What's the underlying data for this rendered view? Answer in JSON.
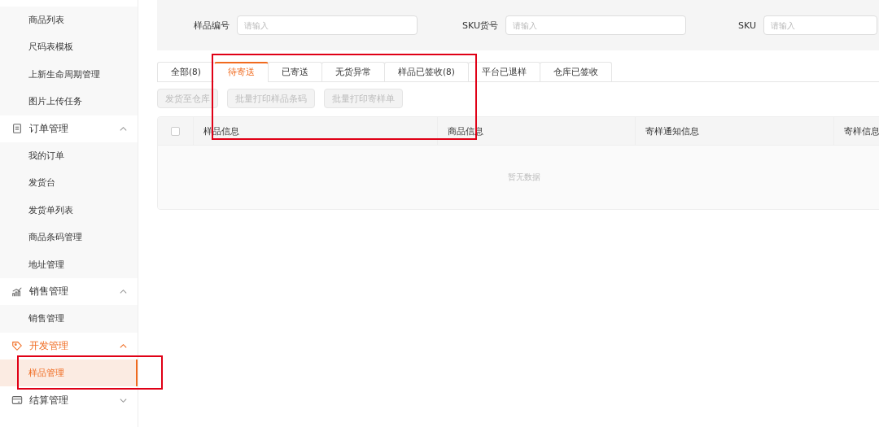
{
  "sidebar": {
    "items": [
      {
        "kind": "sub",
        "label": "商品列表",
        "selected": false
      },
      {
        "kind": "sub",
        "label": "尺码表模板",
        "selected": false
      },
      {
        "kind": "sub",
        "label": "上新生命周期管理",
        "selected": false
      },
      {
        "kind": "sub",
        "label": "图片上传任务",
        "selected": false
      },
      {
        "kind": "group",
        "label": "订单管理",
        "expanded": true,
        "selected": false
      },
      {
        "kind": "sub",
        "label": "我的订单",
        "selected": false
      },
      {
        "kind": "sub",
        "label": "发货台",
        "selected": false
      },
      {
        "kind": "sub",
        "label": "发货单列表",
        "selected": false
      },
      {
        "kind": "sub",
        "label": "商品条码管理",
        "selected": false
      },
      {
        "kind": "sub",
        "label": "地址管理",
        "selected": false
      },
      {
        "kind": "group",
        "label": "销售管理",
        "expanded": true,
        "selected": false
      },
      {
        "kind": "sub",
        "label": "销售管理",
        "selected": false
      },
      {
        "kind": "group",
        "label": "开发管理",
        "expanded": true,
        "selected": true
      },
      {
        "kind": "sub",
        "label": "样品管理",
        "selected": true
      },
      {
        "kind": "group",
        "label": "结算管理",
        "expanded": false,
        "selected": false
      }
    ]
  },
  "filters": [
    {
      "label": "样品编号",
      "placeholder": "请输入"
    },
    {
      "label": "SKU货号",
      "placeholder": "请输入"
    },
    {
      "label": "SKU",
      "placeholder": "请输入"
    }
  ],
  "tabs": [
    {
      "label": "全部(8)",
      "selected": false
    },
    {
      "label": "待寄送",
      "selected": true
    },
    {
      "label": "已寄送",
      "selected": false
    },
    {
      "label": "无货异常",
      "selected": false
    },
    {
      "label": "样品已签收(8)",
      "selected": false
    },
    {
      "label": "平台已退样",
      "selected": false
    },
    {
      "label": "仓库已签收",
      "selected": false
    }
  ],
  "actions": [
    {
      "label": "发货至仓库",
      "disabled": true
    },
    {
      "label": "批量打印样品条码",
      "disabled": true
    },
    {
      "label": "批量打印寄样单",
      "disabled": true
    }
  ],
  "table": {
    "select_all_checked": false,
    "columns": [
      "样品信息",
      "商品信息",
      "寄样通知信息",
      "寄样信息"
    ],
    "empty_text": "暂无数据"
  },
  "annotations": {
    "tabs_box": true,
    "menu_box": true
  }
}
